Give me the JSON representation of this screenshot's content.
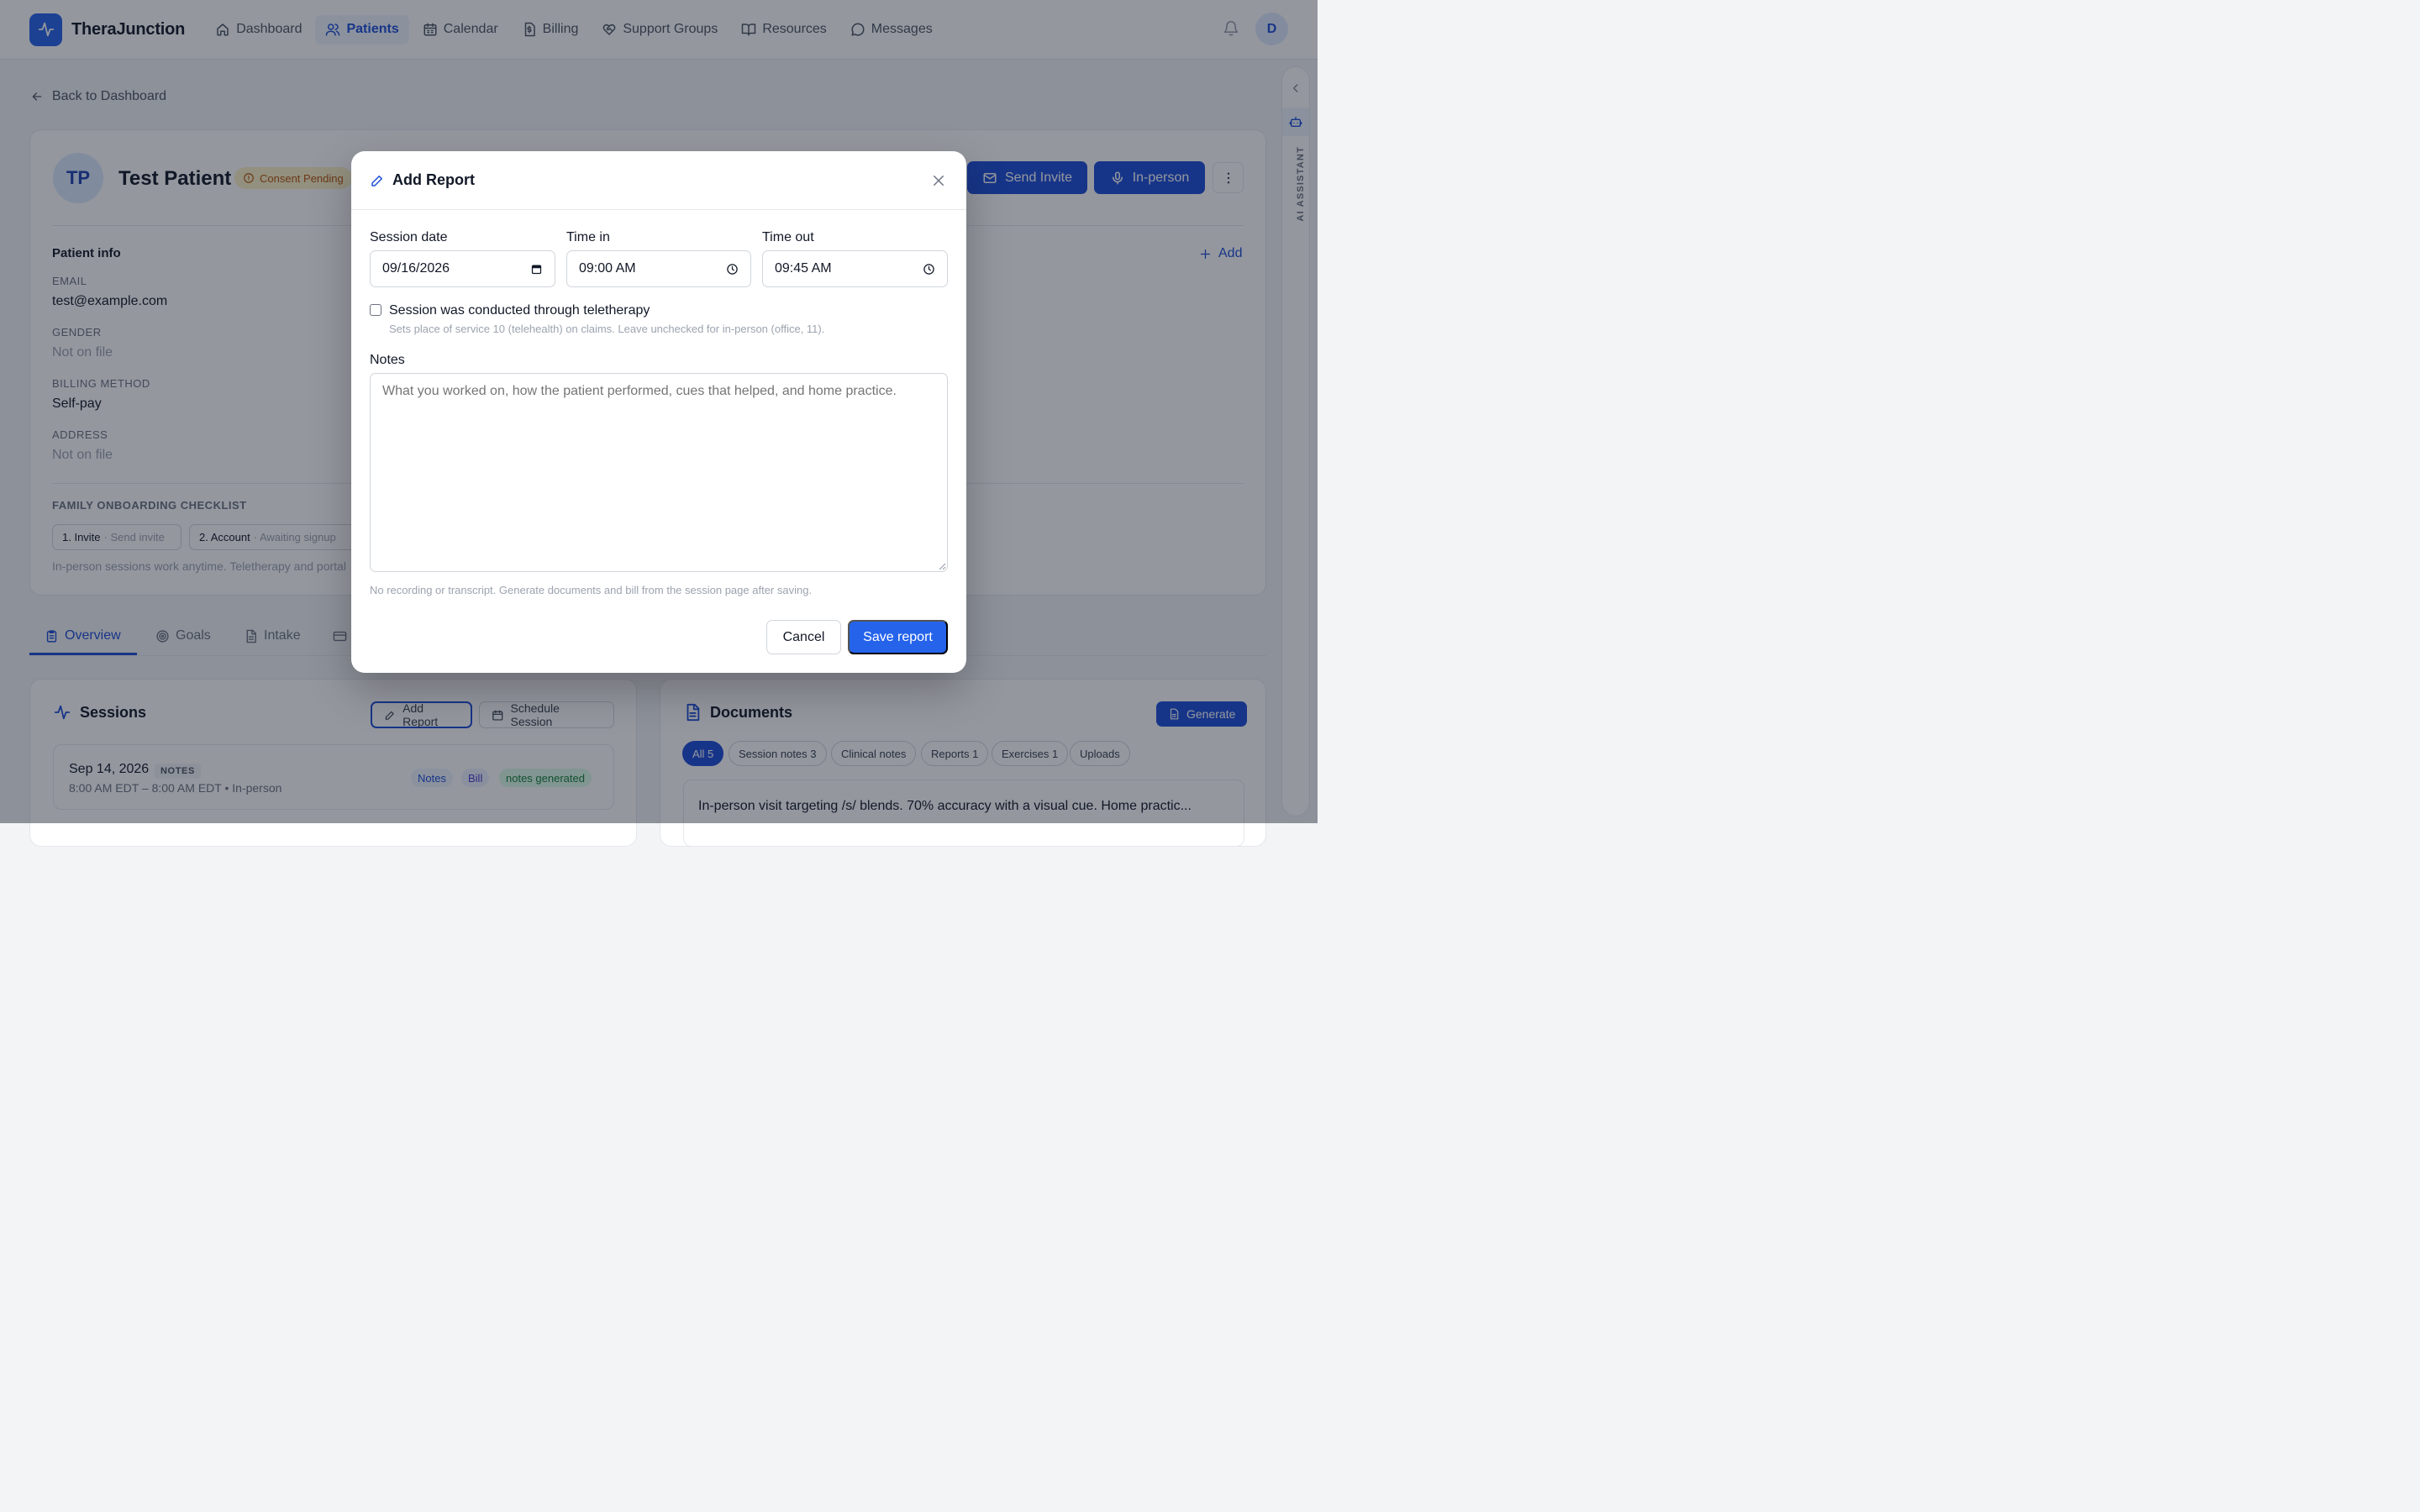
{
  "app": {
    "brand": "TheraJunction",
    "nav": [
      {
        "label": "Dashboard",
        "icon": "home-icon",
        "active": false
      },
      {
        "label": "Patients",
        "icon": "users-icon",
        "active": true
      },
      {
        "label": "Calendar",
        "icon": "calendar-icon",
        "active": false
      },
      {
        "label": "Billing",
        "icon": "dollar-file-icon",
        "active": false
      },
      {
        "label": "Support Groups",
        "icon": "heart-handshake-icon",
        "active": false
      },
      {
        "label": "Resources",
        "icon": "book-open-icon",
        "active": false
      },
      {
        "label": "Messages",
        "icon": "message-circle-icon",
        "active": false
      }
    ],
    "user_initial": "D",
    "accent_color": "#2563eb"
  },
  "back_label": "Back to Dashboard",
  "patient": {
    "initials": "TP",
    "name": "Test Patient",
    "consent_badge": "Consent Pending",
    "send_invite_label": "Send Invite",
    "in_person_label": "In-person",
    "info_title": "Patient info",
    "add_label": "Add",
    "fields": [
      {
        "label": "EMAIL",
        "value": "test@example.com",
        "muted": false
      },
      {
        "label": "GENDER",
        "value": "Not on file",
        "muted": true
      },
      {
        "label": "BILLING METHOD",
        "value": "Self-pay",
        "muted": false
      },
      {
        "label": "ADDRESS",
        "value": "Not on file",
        "muted": true
      }
    ],
    "checklist_title": "FAMILY ONBOARDING CHECKLIST",
    "checklist": [
      {
        "step": "1. Invite",
        "status": "· Send invite"
      },
      {
        "step": "2. Account",
        "status": "· Awaiting signup"
      }
    ],
    "checklist_note": "In-person sessions work anytime. Teletherapy and portal"
  },
  "tabs": [
    {
      "label": "Overview",
      "icon": "clipboard-icon",
      "active": true
    },
    {
      "label": "Goals",
      "icon": "target-icon",
      "active": false
    },
    {
      "label": "Intake",
      "icon": "file-text-icon",
      "active": false
    },
    {
      "label": "",
      "icon": "credit-card-icon",
      "active": false
    }
  ],
  "sessions": {
    "title": "Sessions",
    "add_report_label": "Add Report",
    "schedule_label": "Schedule Session",
    "rows": [
      {
        "date": "Sep 14, 2026",
        "tag": "NOTES",
        "time": "8:00 AM EDT – 8:00 AM EDT • In-person",
        "pills": [
          "Notes",
          "Bill",
          "notes generated"
        ]
      }
    ]
  },
  "documents": {
    "title": "Documents",
    "generate_label": "Generate",
    "filters": [
      {
        "label": "All 5",
        "active": true
      },
      {
        "label": "Session notes 3",
        "active": false
      },
      {
        "label": "Clinical notes",
        "active": false
      },
      {
        "label": "Reports 1",
        "active": false
      },
      {
        "label": "Exercises 1",
        "active": false
      },
      {
        "label": "Uploads",
        "active": false
      }
    ],
    "first_doc": "In-person visit targeting /s/ blends. 70% accuracy with a visual cue. Home practic..."
  },
  "ai_assistant_label": "AI ASSISTANT",
  "modal": {
    "title": "Add Report",
    "session_date_label": "Session date",
    "session_date_value": "09/16/2026",
    "time_in_label": "Time in",
    "time_in_value": "09:00  AM",
    "time_out_label": "Time out",
    "time_out_value": "09:45  AM",
    "teletherapy_label": "Session was conducted through teletherapy",
    "teletherapy_checked": false,
    "teletherapy_help": "Sets place of service 10 (telehealth) on claims. Leave unchecked for in-person (office, 11).",
    "notes_label": "Notes",
    "notes_placeholder": "What you worked on, how the patient performed, cues that helped, and home practice.",
    "notes_help": "No recording or transcript. Generate documents and bill from the session page after saving.",
    "cancel_label": "Cancel",
    "save_label": "Save report"
  }
}
